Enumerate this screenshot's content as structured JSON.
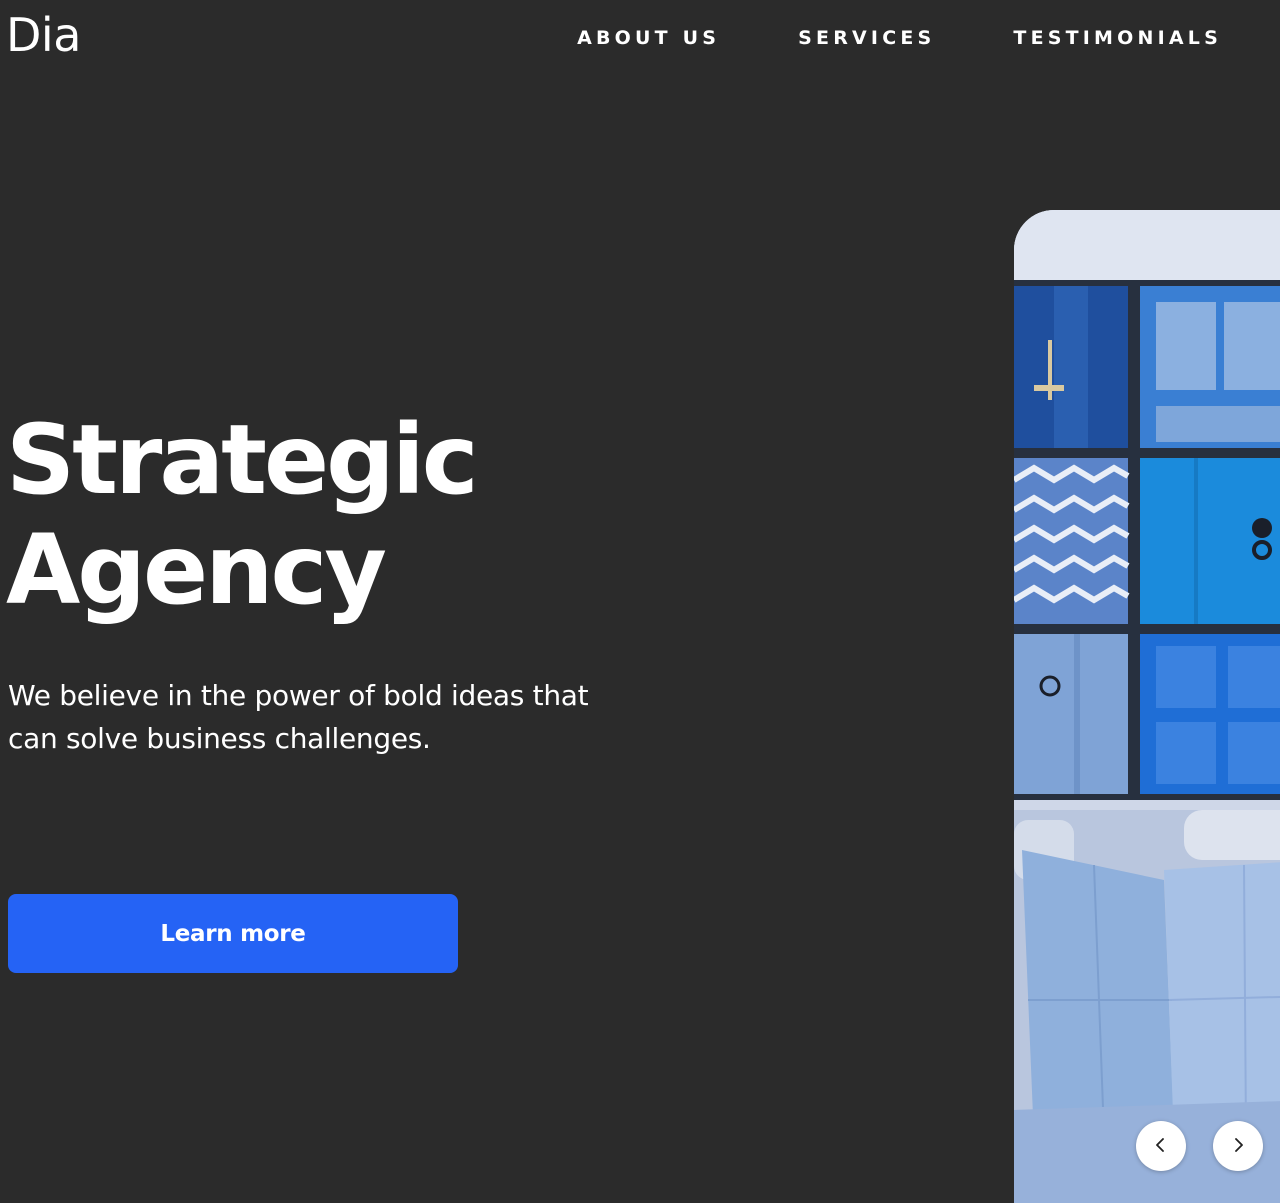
{
  "header": {
    "logo": "Dia",
    "nav": [
      {
        "label": "ABOUT US"
      },
      {
        "label": "SERVICES"
      },
      {
        "label": "TESTIMONIALS"
      }
    ]
  },
  "hero": {
    "title_line1": "Strategic",
    "title_line2": "Agency",
    "tagline": "We believe in the power of bold ideas that can solve business challenges.",
    "cta_label": "Learn more"
  },
  "carousel": {
    "prev_icon": "chevron-left-icon",
    "next_icon": "chevron-right-icon"
  },
  "colors": {
    "background": "#2b2b2b",
    "accent": "#2563f5",
    "text": "#ffffff"
  }
}
